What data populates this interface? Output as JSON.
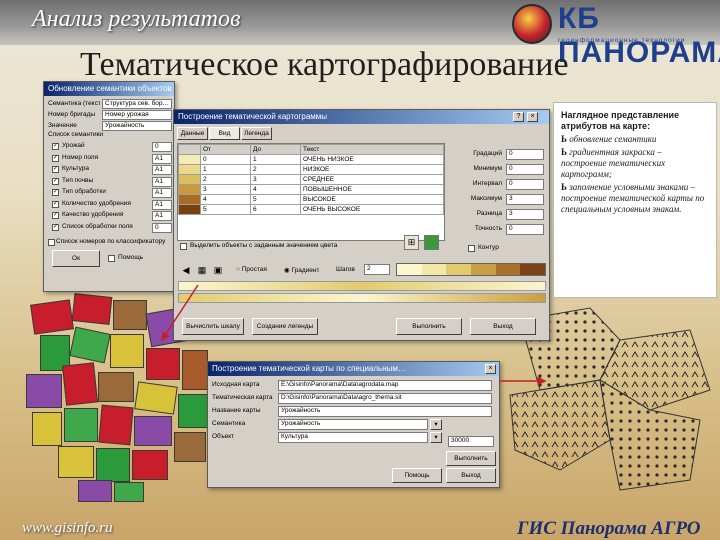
{
  "header": {
    "subtitle": "Анализ результатов",
    "logo_text": "КБ ПАНОРАМА",
    "logo_tagline": "геоинформационные технологии",
    "title": "Тематическое картографирование"
  },
  "win1": {
    "title": "Обновление семантики объектов на карте",
    "rows": [
      {
        "label": "Семантика (текст)",
        "value": "Структура сев. бор…"
      },
      {
        "label": "Номер бригады",
        "value": "Номер урожая"
      },
      {
        "label": "Значение",
        "value": "Урожайность"
      }
    ],
    "group": "Список семантики",
    "sem_items": [
      {
        "label": "Урожай",
        "code": "0"
      },
      {
        "label": "Номер поля",
        "code": "А1"
      },
      {
        "label": "Культура",
        "code": "А1"
      },
      {
        "label": "Тип почвы",
        "code": "А1"
      },
      {
        "label": "Тип обработки",
        "code": "А1"
      },
      {
        "label": "Количество удобрения",
        "code": "А1"
      },
      {
        "label": "Качество удобрения",
        "code": "А1"
      },
      {
        "label": "Список обработки поля",
        "code": "0"
      }
    ],
    "bottom_label": "Список номеров по классификатору",
    "ok": "Ок",
    "help": "Помощь"
  },
  "win2": {
    "title": "Построение тематической картограммы",
    "tabs": [
      "Данные",
      "Вид",
      "Легенда"
    ],
    "cols": [
      "От",
      "До",
      "Текст"
    ],
    "rows": [
      {
        "from": "0",
        "to": "1",
        "text": "ОЧЕНЬ НИЗКОЕ",
        "color": "#f3ecb5"
      },
      {
        "from": "1",
        "to": "2",
        "text": "НИЗКОЕ",
        "color": "#ead98a"
      },
      {
        "from": "2",
        "to": "3",
        "text": "СРЕДНЕЕ",
        "color": "#d9bf5c"
      },
      {
        "from": "3",
        "to": "4",
        "text": "ПОВЫШЕННОЕ",
        "color": "#c99a3a"
      },
      {
        "from": "4",
        "to": "5",
        "text": "ВЫСОКОЕ",
        "color": "#a96a22"
      },
      {
        "from": "5",
        "to": "6",
        "text": "ОЧЕНЬ ВЫСОКОЕ",
        "color": "#7a4012"
      }
    ],
    "side_fields": [
      {
        "label": "Градаций",
        "value": "0"
      },
      {
        "label": "Минимум",
        "value": "0"
      },
      {
        "label": "Интервал",
        "value": "0"
      },
      {
        "label": "Максимум",
        "value": "3"
      },
      {
        "label": "Разница",
        "value": "3"
      },
      {
        "label": "Точность",
        "value": "0"
      }
    ],
    "contour": "Контур",
    "check_label": "Выделить объекты с заданным значением цвета",
    "radio_simple": "Простая",
    "radio_gradient": "Градиент",
    "steps_label": "Шагов",
    "steps_value": "2",
    "btn_calc": "Вычислить шкалу",
    "btn_build": "Создание легенды",
    "btn_ok": "Выполнить",
    "btn_close": "Выход",
    "gradient_colors": [
      "#fbf6d0",
      "#f2e7a6",
      "#e2cb6e",
      "#c9a043",
      "#a8702a",
      "#7c4316"
    ]
  },
  "win3": {
    "title": "Построение тематической карты по специальным…",
    "fields": [
      {
        "label": "Исходная карта",
        "value": "E:\\Gisinfo\\Panorama\\Data\\agrodata.map"
      },
      {
        "label": "Тематическая карта",
        "value": "D:\\Gisinfo\\Panorama\\Data\\agro_thema.sit"
      },
      {
        "label": "Название карты",
        "value": "Урожайность"
      },
      {
        "label": "Семантика",
        "value": "Урожайность"
      },
      {
        "label": "Объект",
        "value": "Культура"
      }
    ],
    "code_value": "30000",
    "btn_ok": "Выполнить",
    "btn_cancel": "Выход",
    "btn_help": "Помощь"
  },
  "right_panel": {
    "heading": "Наглядное представление атрибутов на карте:",
    "items": [
      "обновление семантики",
      "градиентная закраска – построение тематических картограмм;",
      "заполнение условными знаками – построение тематической карты по специальным условным знакам."
    ],
    "bullet": "Ь"
  },
  "footer": {
    "url": "www.gisinfo.ru",
    "product": "ГИС Панорама АГРО"
  },
  "colors": {
    "title_blue": "#0a246a",
    "brand_blue": "#1e3f8c",
    "window_gray": "#d4d0c8",
    "arrow_red": "#c0202a"
  },
  "icons": [
    "globe-logo-icon",
    "close-icon",
    "question-icon",
    "table-icon",
    "color-icon",
    "arrow-icon"
  ]
}
